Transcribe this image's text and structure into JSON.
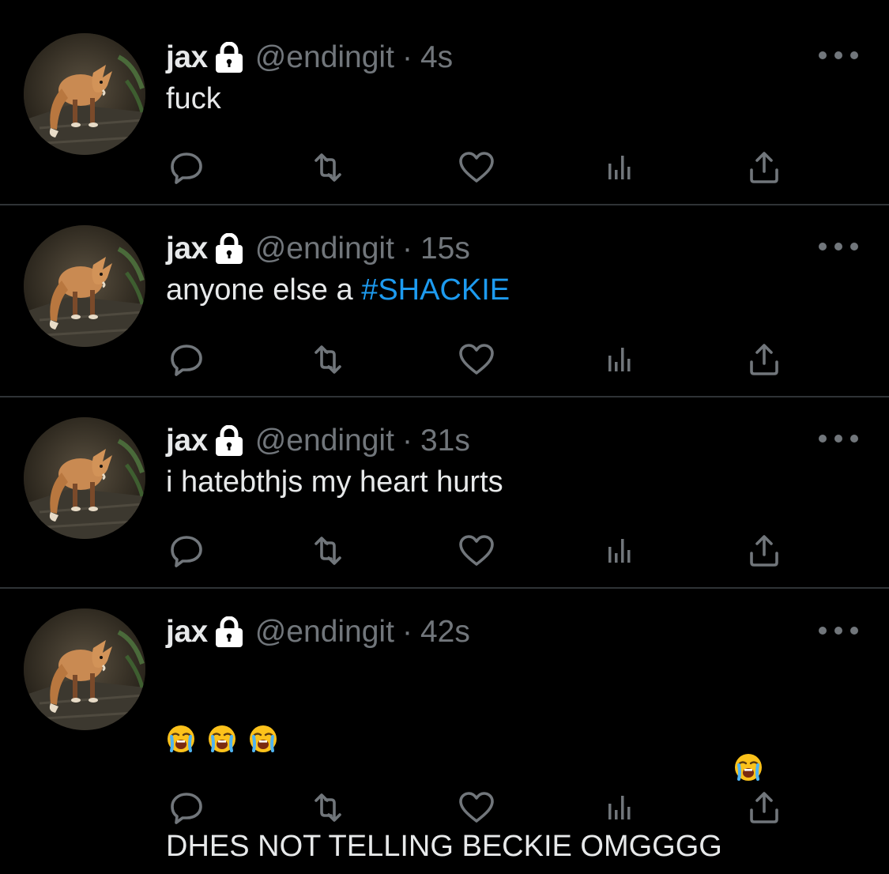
{
  "colors": {
    "background": "#000000",
    "text": "#e7e9ea",
    "muted": "#71767b",
    "hashtag": "#1d9bf0",
    "separator": "#2f3336"
  },
  "tweets": [
    {
      "name": "jax",
      "handle": "@endingit",
      "separator": "·",
      "time": "4s",
      "text": "fuck"
    },
    {
      "name": "jax",
      "handle": "@endingit",
      "separator": "·",
      "time": "15s",
      "text_prefix": "anyone else a ",
      "hashtag": "#SHACKIE"
    },
    {
      "name": "jax",
      "handle": "@endingit",
      "separator": "·",
      "time": "31s",
      "text": "i hatebthjs my heart hurts"
    },
    {
      "name": "jax",
      "handle": "@endingit",
      "separator": "·",
      "time": "42s",
      "text": "DHES NOT TELLING BECKIE OMGGGG",
      "emojis": [
        "loudly-crying-face",
        "loudly-crying-face",
        "loudly-crying-face",
        "loudly-crying-face"
      ]
    }
  ],
  "icons": {
    "avatar": "fox-photo-avatar",
    "lock": "lock-icon",
    "more": "more-horizontal-icon",
    "reply": "reply-icon",
    "retweet": "retweet-icon",
    "like": "heart-icon",
    "views": "analytics-icon",
    "share": "share-icon"
  }
}
